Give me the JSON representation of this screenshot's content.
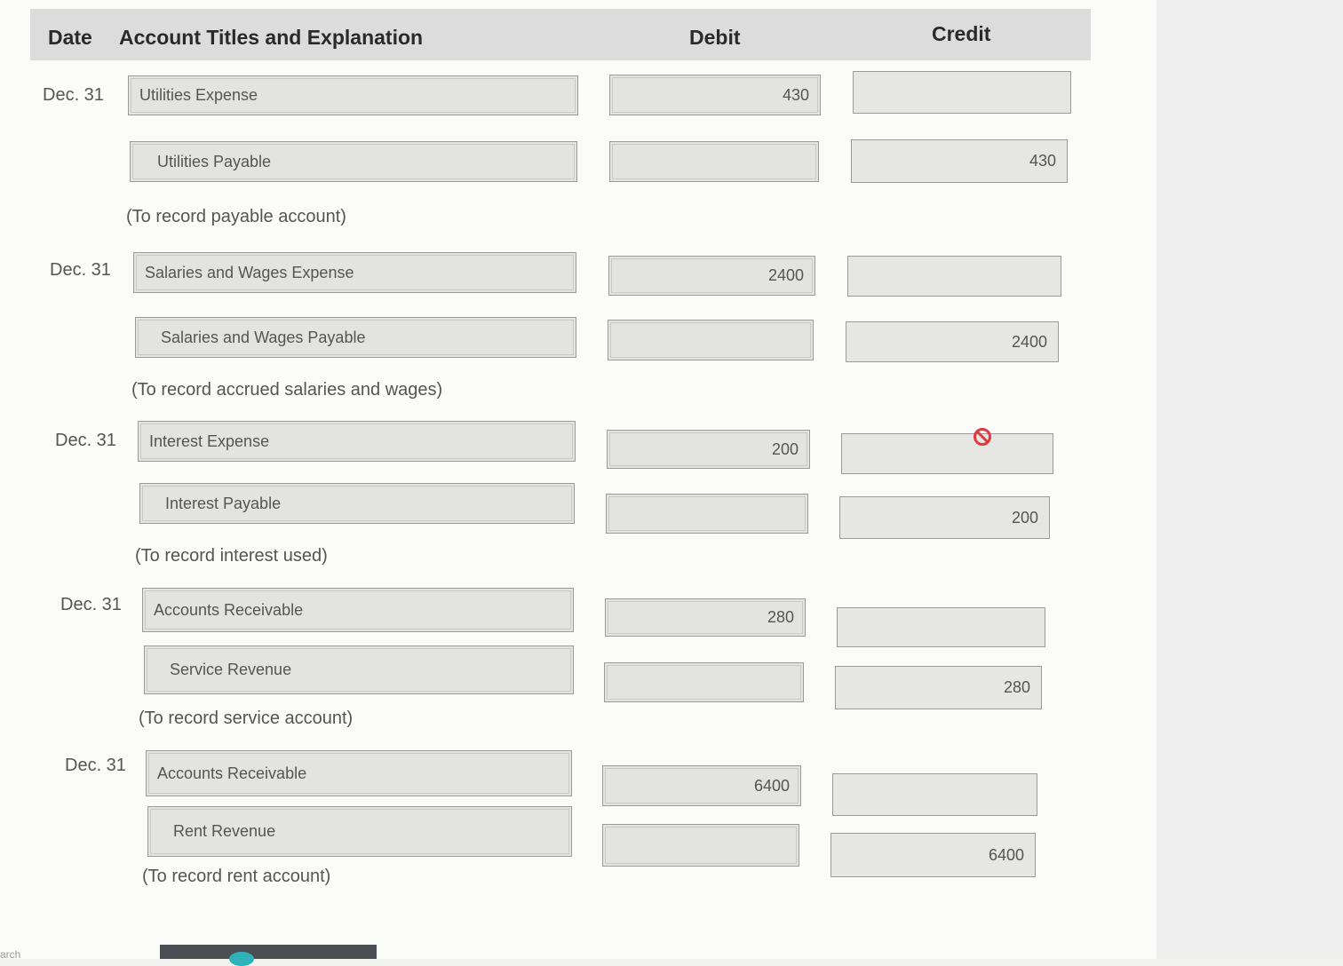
{
  "header": {
    "date": "Date",
    "account": "Account Titles and Explanation",
    "debit": "Debit",
    "credit": "Credit"
  },
  "entries": [
    {
      "date": "Dec. 31",
      "debit_account": "Utilities Expense",
      "credit_account": "Utilities Payable",
      "debit_amount": "430",
      "credit_amount": "430",
      "explanation": "(To record payable account)"
    },
    {
      "date": "Dec. 31",
      "debit_account": "Salaries and Wages Expense",
      "credit_account": "Salaries and Wages Payable",
      "debit_amount": "2400",
      "credit_amount": "2400",
      "explanation": "(To record accrued salaries and wages)"
    },
    {
      "date": "Dec. 31",
      "debit_account": "Interest Expense",
      "credit_account": "Interest Payable",
      "debit_amount": "200",
      "credit_amount": "200",
      "explanation": "(To record interest used)"
    },
    {
      "date": "Dec. 31",
      "debit_account": "Accounts Receivable",
      "credit_account": "Service Revenue",
      "debit_amount": "280",
      "credit_amount": "280",
      "explanation": "(To record service account)"
    },
    {
      "date": "Dec. 31",
      "debit_account": "Accounts Receivable",
      "credit_account": "Rent Revenue",
      "debit_amount": "6400",
      "credit_amount": "6400",
      "explanation": "(To record rent account)"
    }
  ],
  "icons": {
    "blocked_cursor": "not-allowed-icon",
    "blocked_color": "#e0393e"
  },
  "taskbar": {
    "search_fragment": "arch"
  }
}
